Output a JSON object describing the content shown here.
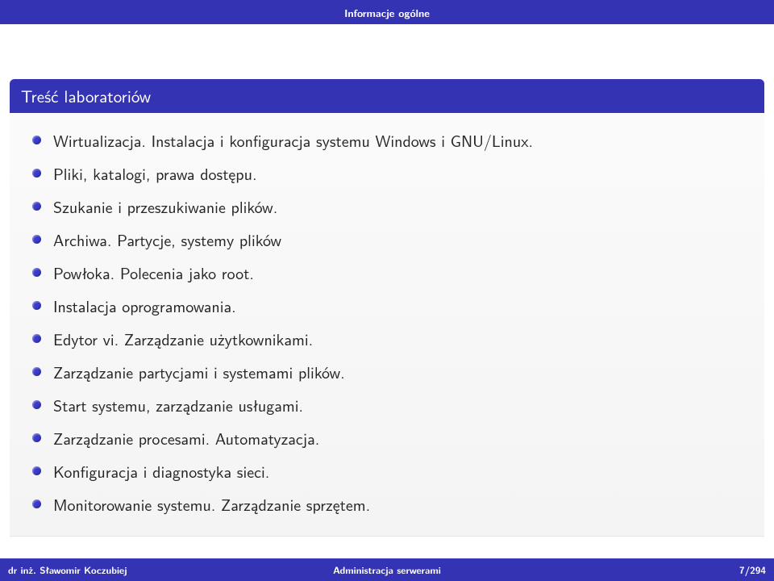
{
  "header": {
    "section": "Informacje ogólne"
  },
  "block": {
    "title": "Treść laboratoriów",
    "items": [
      "Wirtualizacja. Instalacja i konfiguracja systemu Windows i GNU/Linux.",
      "Pliki, katalogi, prawa dostępu.",
      "Szukanie i przeszukiwanie plików.",
      "Archiwa. Partycje, systemy plików",
      "Powłoka. Polecenia jako root.",
      "Instalacja oprogramowania.",
      "Edytor vi. Zarządzanie użytkownikami.",
      "Zarządzanie partycjami i systemami plików.",
      "Start systemu, zarządzanie usługami.",
      "Zarządzanie procesami. Automatyzacja.",
      "Konfiguracja i diagnostyka sieci.",
      "Monitorowanie systemu. Zarządzanie sprzętem."
    ]
  },
  "footer": {
    "author": "dr inż. Sławomir Koczubiej",
    "title": "Administracja serwerami",
    "page": "7/294"
  }
}
